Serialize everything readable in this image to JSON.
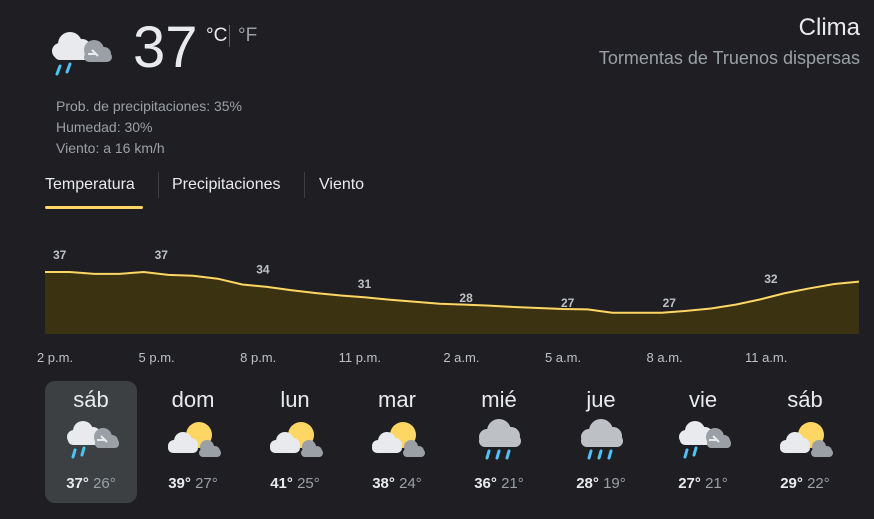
{
  "current": {
    "temperature": "37",
    "unit_c": "°C",
    "unit_f": "°F",
    "icon": "thunderstorm-scattered-icon",
    "precipitation": "Prob. de precipitaciones: 35%",
    "humidity": "Humedad: 30%",
    "wind": "Viento: a 16 km/h"
  },
  "header": {
    "title": "Clima",
    "subtitle": "Tormentas de Truenos dispersas"
  },
  "tabs": [
    {
      "label": "Temperatura",
      "selected": true
    },
    {
      "label": "Precipitaciones",
      "selected": false
    },
    {
      "label": "Viento",
      "selected": false
    }
  ],
  "colors": {
    "accent": "#fdd663",
    "chart_fill": "#3b3212",
    "background": "#1f1f23",
    "selected_day": "#3c4043"
  },
  "chart_data": {
    "type": "area",
    "x": [
      "2 p.m.",
      "5 p.m.",
      "8 p.m.",
      "11 p.m.",
      "2 a.m.",
      "5 a.m.",
      "8 a.m.",
      "11 a.m."
    ],
    "labels": [
      "37",
      "37",
      "34",
      "31",
      "28",
      "27",
      "27",
      "32"
    ],
    "values": [
      37,
      37,
      34,
      31,
      28,
      27,
      27,
      32
    ],
    "curve": [
      37,
      37,
      36.6,
      36.6,
      37,
      36.4,
      36.2,
      35.6,
      34.4,
      33.9,
      33.2,
      32.6,
      32.1,
      31.7,
      31.2,
      30.8,
      30.4,
      30.2,
      30,
      29.7,
      29.5,
      29.3,
      29.2,
      28.5,
      28.5,
      28.5,
      28.9,
      29.4,
      30.2,
      31.3,
      32.6,
      33.6,
      34.5,
      35
    ]
  },
  "days": [
    {
      "name": "sáb",
      "hi": "37°",
      "lo": "26°",
      "icon": "thunderstorm-scattered-icon",
      "selected": true
    },
    {
      "name": "dom",
      "hi": "39°",
      "lo": "27°",
      "icon": "partly-cloudy-icon",
      "selected": false
    },
    {
      "name": "lun",
      "hi": "41°",
      "lo": "25°",
      "icon": "partly-cloudy-icon",
      "selected": false
    },
    {
      "name": "mar",
      "hi": "38°",
      "lo": "24°",
      "icon": "partly-cloudy-icon",
      "selected": false
    },
    {
      "name": "mié",
      "hi": "36°",
      "lo": "21°",
      "icon": "rain-icon",
      "selected": false
    },
    {
      "name": "jue",
      "hi": "28°",
      "lo": "19°",
      "icon": "rain-icon",
      "selected": false
    },
    {
      "name": "vie",
      "hi": "27°",
      "lo": "21°",
      "icon": "thunderstorm-scattered-icon",
      "selected": false
    },
    {
      "name": "sáb",
      "hi": "29°",
      "lo": "22°",
      "icon": "partly-cloudy-icon",
      "selected": false
    }
  ]
}
